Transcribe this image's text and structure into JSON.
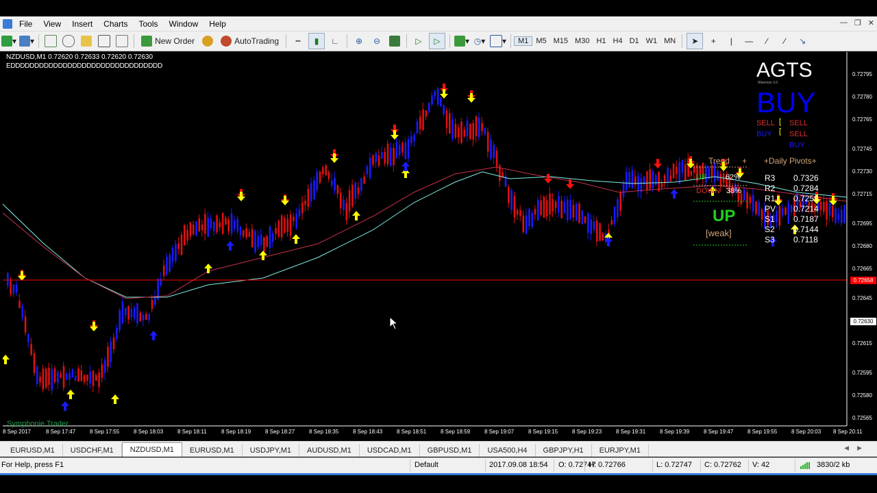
{
  "menu": {
    "items": [
      "File",
      "View",
      "Insert",
      "Charts",
      "Tools",
      "Window",
      "Help"
    ]
  },
  "toolbar": {
    "new_order_label": "New Order",
    "autotrading_label": "AutoTrading",
    "timeframes": [
      "M1",
      "M5",
      "M15",
      "M30",
      "H1",
      "H4",
      "D1",
      "W1",
      "MN"
    ],
    "active_timeframe": "M1"
  },
  "chart": {
    "title": "NZDUSD,M1  0.72620 0.72633 0.72620 0.72630",
    "subtitle": "EDDDDDDDDDDDDDDDDDDDDDDDDDDDDDDDD",
    "watermark": "Symphonie Trader",
    "colors": {
      "background": "#000000",
      "bull_candle": "#1a1aff",
      "bear_candle": "#e01010",
      "ma_cyan": "#7ff0e8",
      "ma_red": "#c8304a",
      "bid_line": "#ff0000",
      "arrow_up_yellow": "#ffff00",
      "arrow_up_blue": "#1a1aff",
      "arrow_down_red": "#ff1010"
    },
    "price_axis": [
      "0.72795",
      "0.72780",
      "0.72765",
      "0.72745",
      "0.72730",
      "0.72715",
      "0.72695",
      "0.72680",
      "0.72665",
      "0.72645",
      "0.72630",
      "0.72615",
      "0.72595",
      "0.72580",
      "0.72565"
    ],
    "bid_price_tag": "0.72658",
    "current_price_tag": "0.72630",
    "time_axis": [
      "8 Sep 2017",
      "8 Sep 17:47",
      "8 Sep 17:55",
      "8 Sep 18:03",
      "8 Sep 18:11",
      "8 Sep 18:19",
      "8 Sep 18:27",
      "8 Sep 18:35",
      "8 Sep 18:43",
      "8 Sep 18:51",
      "8 Sep 18:59",
      "8 Sep 19:07",
      "8 Sep 19:15",
      "8 Sep 19:23",
      "8 Sep 19:31",
      "8 Sep 19:39",
      "8 Sep 19:47",
      "8 Sep 19:55",
      "8 Sep 20:03",
      "8 Sep 20:11"
    ]
  },
  "indicator": {
    "name": "AGTS",
    "name_sub": "Wiseman 3.0",
    "signal": "BUY",
    "signal_rows": [
      {
        "left": "SELL",
        "left_color": "#e03030",
        "right": "SELL",
        "right_color": "#e03030"
      },
      {
        "left": "BUY",
        "left_color": "#1a1aff",
        "right": "SELL",
        "right_color": "#e03030"
      },
      {
        "left": "",
        "left_color": "#1a1aff",
        "right": "BUY",
        "right_color": "#1a1aff"
      }
    ],
    "trend_label": "Trend",
    "trend_plus": "+",
    "up_label": "UP",
    "up_pct": "62%",
    "down_label": "DOWN",
    "down_pct": "38%",
    "trend_direction": "UP",
    "trend_strength": "[weak]",
    "pivots_title": "+Daily Pivots+",
    "pivots": [
      {
        "name": "R3",
        "value": "0.7326"
      },
      {
        "name": "R2",
        "value": "0.7284"
      },
      {
        "name": "R1",
        "value": "0.7259"
      },
      {
        "name": "PV",
        "value": "0.7214"
      },
      {
        "name": "S1",
        "value": "0.7187"
      },
      {
        "name": "S2",
        "value": "0.7144"
      },
      {
        "name": "S3",
        "value": "0.7118"
      }
    ]
  },
  "tabs": [
    "EURUSD,M1",
    "USDCHF,M1",
    "NZDUSD,M1",
    "EURUSD,M1",
    "USDJPY,M1",
    "AUDUSD,M1",
    "USDCAD,M1",
    "GBPUSD,M1",
    "USA500,H4",
    "GBPJPY,H1",
    "EURJPY,M1"
  ],
  "active_tab": "NZDUSD,M1",
  "status": {
    "help": "For Help, press F1",
    "profile": "Default",
    "datetime": "2017.09.08 18:54",
    "open": "O: 0.72747",
    "high": "H: 0.72766",
    "low": "L: 0.72747",
    "close": "C: 0.72762",
    "volume": "V: 42",
    "connection": "3830/2 kb"
  }
}
